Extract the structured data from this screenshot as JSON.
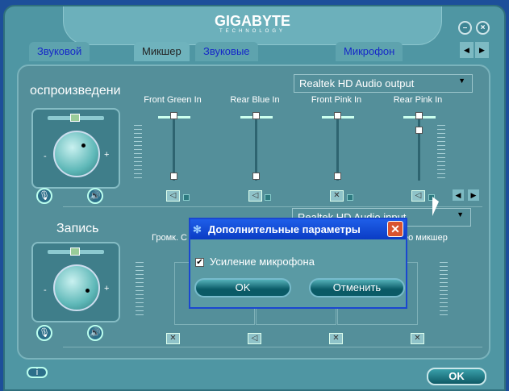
{
  "brand": {
    "name": "GIGABYTE",
    "sub": "TECHNOLOGY"
  },
  "window": {
    "minimize": "–",
    "close": "×"
  },
  "tabs": [
    {
      "label": "Звуковой эффект"
    },
    {
      "label": "Микшер"
    },
    {
      "label": "Звуковые входы/выходы"
    },
    {
      "label": "Микрофон"
    }
  ],
  "tab_nav": {
    "prev": "◀",
    "next": "▶"
  },
  "playback": {
    "title": "оспроизведени",
    "device": "Realtek HD Audio output",
    "channels": [
      {
        "label": "Front Green In",
        "level": 0,
        "muted": false
      },
      {
        "label": "Rear Blue In",
        "level": 0,
        "muted": false
      },
      {
        "label": "Front Pink In",
        "level": 0,
        "muted": true
      },
      {
        "label": "Rear Pink In",
        "level": 0.82,
        "muted": false
      }
    ]
  },
  "record": {
    "title": "Запись",
    "label_left": "Громк. С",
    "label_right": "ео микшер",
    "device": "Realtek HD Audio input"
  },
  "knob": {
    "minus": "-",
    "plus": "+"
  },
  "ok_label": "OK",
  "dialog": {
    "title": "Дополнительные параметры",
    "close": "✕",
    "checkbox_label": "Усиление микрофона",
    "checked": true,
    "ok": "OK",
    "cancel": "Отменить"
  }
}
